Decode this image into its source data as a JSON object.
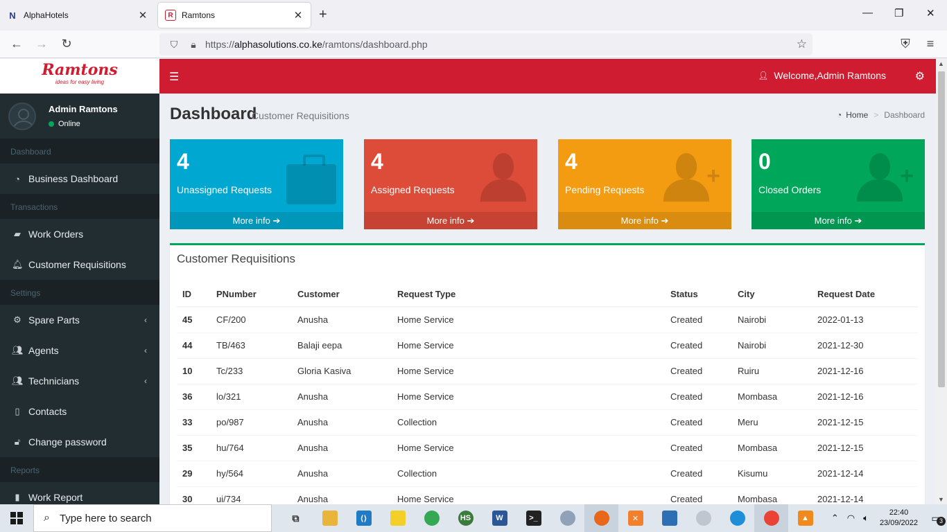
{
  "browser": {
    "tabs": [
      {
        "title": "AlphaHotels",
        "favicon": "N"
      },
      {
        "title": "Ramtons",
        "favicon": "R"
      }
    ],
    "url_prefix": "https://",
    "url_domain": "alphasolutions.co.ke",
    "url_path": "/ramtons/dashboard.php"
  },
  "sidebar": {
    "logo_text": "Ramtons",
    "logo_tagline": "ideas for easy living",
    "user_name": "Admin Ramtons",
    "user_status": "Online",
    "sections": [
      {
        "header": "Dashboard",
        "items": [
          {
            "label": "Business Dashboard",
            "icon": "dashboard-icon"
          }
        ]
      },
      {
        "header": "Transactions",
        "items": [
          {
            "label": "Work Orders",
            "icon": "briefcase-icon"
          },
          {
            "label": "Customer Requisitions",
            "icon": "bell-icon"
          }
        ]
      },
      {
        "header": "Settings",
        "items": [
          {
            "label": "Spare Parts",
            "icon": "cogs-icon"
          },
          {
            "label": "Agents",
            "icon": "users-icon"
          },
          {
            "label": "Technicians",
            "icon": "users-icon"
          },
          {
            "label": "Contacts",
            "icon": "address-book-icon"
          },
          {
            "label": "Change password",
            "icon": "unlock-icon"
          }
        ]
      },
      {
        "header": "Reports",
        "items": [
          {
            "label": "Work Report",
            "icon": "chart-icon"
          }
        ]
      }
    ]
  },
  "header": {
    "welcome": "Welcome,Admin Ramtons"
  },
  "content": {
    "title": "Dashboard",
    "subtitle": "Customer Requisitions",
    "breadcrumb_home": "Home",
    "breadcrumb_current": "Dashboard",
    "boxes": [
      {
        "count": "4",
        "label": "Unassigned Requests",
        "more": "More info",
        "color": "#00a7d0"
      },
      {
        "count": "4",
        "label": "Assigned Requests",
        "more": "More info",
        "color": "#dd4b39"
      },
      {
        "count": "4",
        "label": "Pending Requests",
        "more": "More info",
        "color": "#f39c12"
      },
      {
        "count": "0",
        "label": "Closed Orders",
        "more": "More info",
        "color": "#00a65a"
      }
    ],
    "panel_title": "Customer Requisitions",
    "table": {
      "columns": [
        "ID",
        "PNumber",
        "Customer",
        "Request Type",
        "Status",
        "City",
        "Request Date"
      ],
      "rows": [
        [
          "45",
          "CF/200",
          "Anusha",
          "Home Service",
          "Created",
          "Nairobi",
          "2022-01-13"
        ],
        [
          "44",
          "TB/463",
          "Balaji eepa",
          "Home Service",
          "Created",
          "Nairobi",
          "2021-12-30"
        ],
        [
          "10",
          "Tc/233",
          "Gloria Kasiva",
          "Home Service",
          "Created",
          "Ruiru",
          "2021-12-16"
        ],
        [
          "36",
          "lo/321",
          "Anusha",
          "Home Service",
          "Created",
          "Mombasa",
          "2021-12-16"
        ],
        [
          "33",
          "po/987",
          "Anusha",
          "Collection",
          "Created",
          "Meru",
          "2021-12-15"
        ],
        [
          "35",
          "hu/764",
          "Anusha",
          "Home Service",
          "Created",
          "Mombasa",
          "2021-12-15"
        ],
        [
          "29",
          "hy/564",
          "Anusha",
          "Collection",
          "Created",
          "Kisumu",
          "2021-12-14"
        ],
        [
          "30",
          "ui/734",
          "Anusha",
          "Home Service",
          "Created",
          "Mombasa",
          "2021-12-14"
        ]
      ]
    }
  },
  "taskbar": {
    "search_placeholder": "Type here to search",
    "time": "22:40",
    "date": "23/09/2022",
    "notification_count": "3"
  },
  "colors": {
    "brand_red": "#d01c30",
    "sidebar_bg": "#222d32",
    "success_green": "#00a65a"
  }
}
